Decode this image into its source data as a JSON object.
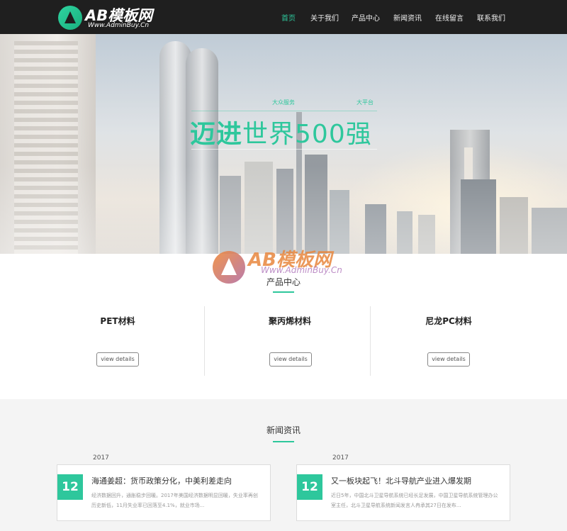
{
  "brand": {
    "logo_text": "AB模板网",
    "logo_sub": "Www.AdminBuy.Cn"
  },
  "nav": {
    "items": [
      {
        "label": "首页",
        "active": true
      },
      {
        "label": "关于我们"
      },
      {
        "label": "产品中心"
      },
      {
        "label": "新闻资讯"
      },
      {
        "label": "在线留言"
      },
      {
        "label": "联系我们"
      }
    ]
  },
  "banner": {
    "tags": [
      "",
      "大众服务",
      "大平台"
    ],
    "headline_strong": "迈进",
    "headline_rest": "世界500强"
  },
  "products": {
    "title": "产品中心",
    "items": [
      {
        "name": "PET材料",
        "button": "view details"
      },
      {
        "name": "聚丙烯材料",
        "button": "view details"
      },
      {
        "name": "尼龙PC材料",
        "button": "view details"
      }
    ]
  },
  "news": {
    "title": "新闻资讯",
    "items": [
      {
        "year": "2017",
        "day": "12",
        "title": "海通姜超：货币政策分化，中美利差走向",
        "excerpt": "经济数据回升，通胀稳步回暖。2017年美国经济数据明显回暖，失业率再创历史新低，11月失业率已回落至4.1%，就业市场..."
      },
      {
        "year": "2017",
        "day": "12",
        "title": "又一板块起飞！北斗导航产业进入爆发期",
        "excerpt": "近日5年，中国北斗卫星导航系统已经长足发展，中国卫星导航系统管理办公室主任，北斗卫星导航系统新闻发言人冉承其27日在发布..."
      }
    ]
  },
  "watermark": {
    "title": "AB模板网",
    "sub": "Www.AdminBuy.Cn"
  },
  "colors": {
    "accent": "#2ec79c",
    "header_bg": "#1f1f1f"
  }
}
